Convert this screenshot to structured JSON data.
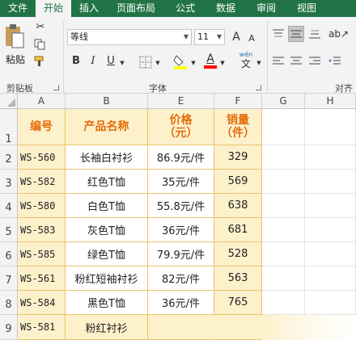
{
  "ribbon": {
    "tabs": [
      "文件",
      "开始",
      "插入",
      "页面布局",
      "公式",
      "数据",
      "审阅",
      "视图"
    ],
    "active_tab": 1,
    "paste_label": "粘贴",
    "clipboard_label": "剪贴板",
    "font_label": "字体",
    "align_label": "对齐",
    "font_name": "等线",
    "font_size": "11",
    "grow_font": "A",
    "shrink_font": "A",
    "bold": "B",
    "italic": "I",
    "underline": "U",
    "font_color_letter": "A",
    "wen_label": "wén",
    "wen_char": "文"
  },
  "sheet": {
    "columns": [
      "A",
      "B",
      "E",
      "F",
      "G",
      "H"
    ],
    "rows": [
      "1",
      "2",
      "3",
      "4",
      "5",
      "6",
      "7",
      "8",
      "9"
    ],
    "header": {
      "code": "编号",
      "name": "产品名称",
      "price_line1": "价格",
      "price_line2": "（元）",
      "sales_line1": "销量",
      "sales_line2": "（件）"
    },
    "data": [
      {
        "code": "WS-560",
        "name": "长袖白衬衫",
        "price": "86.9元/件",
        "sales": "329"
      },
      {
        "code": "WS-582",
        "name": "红色T恤",
        "price": "35元/件",
        "sales": "569"
      },
      {
        "code": "WS-580",
        "name": "白色T恤",
        "price": "55.8元/件",
        "sales": "638"
      },
      {
        "code": "WS-583",
        "name": "灰色T恤",
        "price": "36元/件",
        "sales": "681"
      },
      {
        "code": "WS-585",
        "name": "绿色T恤",
        "price": "79.9元/件",
        "sales": "528"
      },
      {
        "code": "WS-561",
        "name": "粉红短袖衬衫",
        "price": "82元/件",
        "sales": "563"
      },
      {
        "code": "WS-584",
        "name": "黑色T恤",
        "price": "36元/件",
        "sales": "765"
      },
      {
        "code": "WS-581",
        "name": "粉红衬衫",
        "price": "",
        "sales": ""
      }
    ]
  },
  "colors": {
    "brand": "#217346",
    "header_text": "#e46c0a",
    "cell_fill": "#fdf1cc",
    "cell_border": "#e9c46a"
  }
}
